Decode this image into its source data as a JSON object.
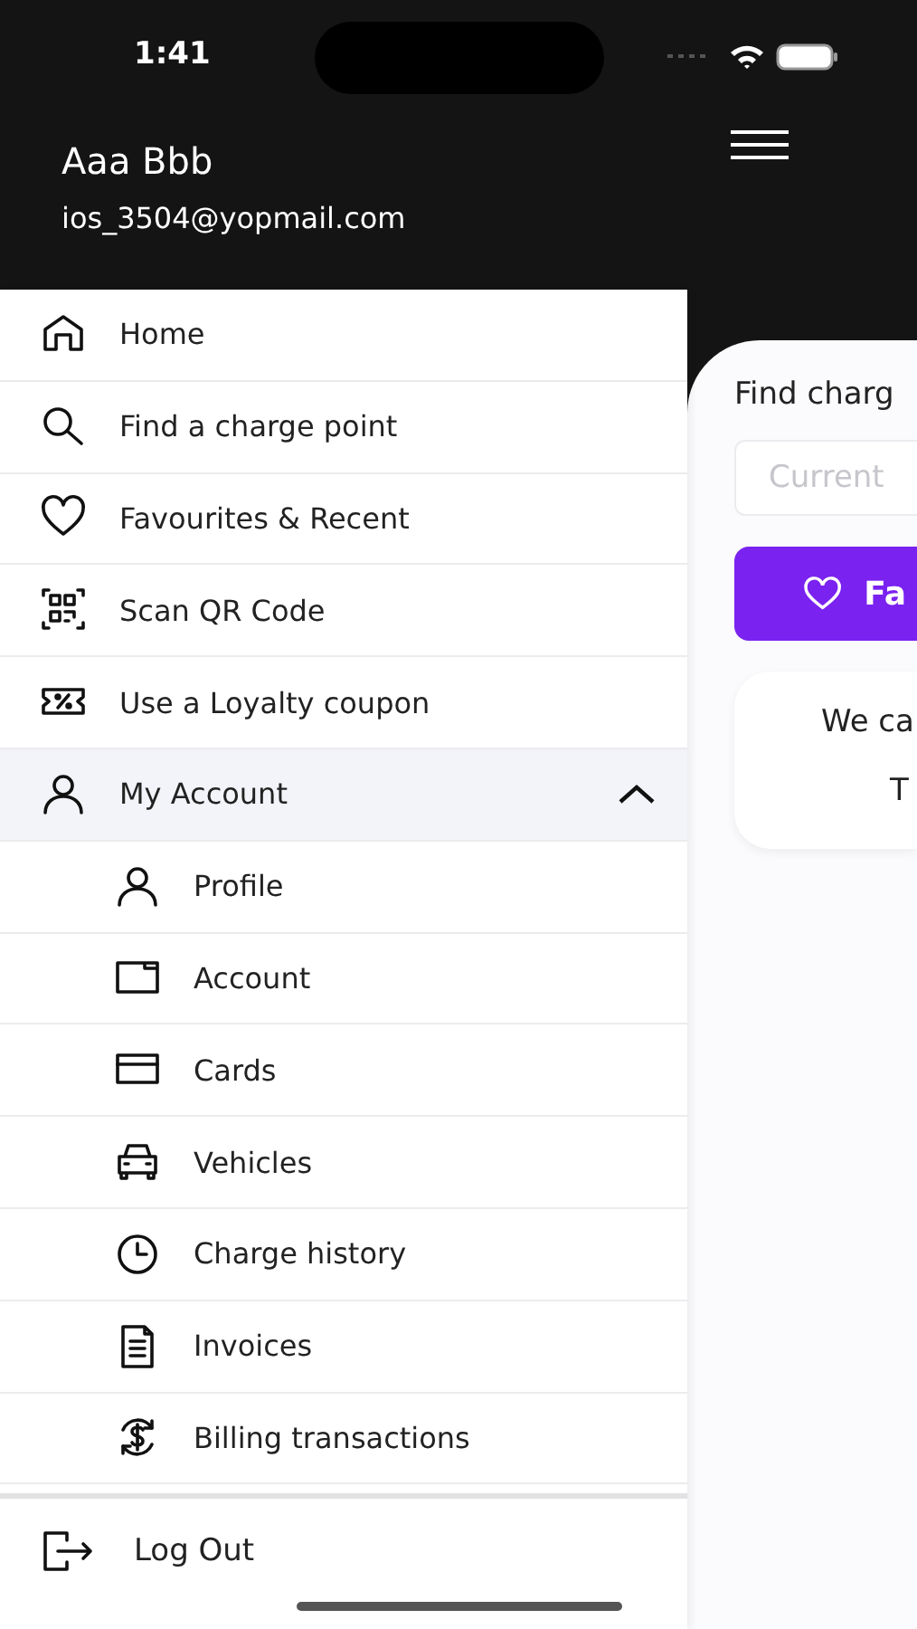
{
  "status_bar": {
    "time": "1:41"
  },
  "drawer": {
    "user_name": "Aaa Bbb",
    "email": "ios_3504@yopmail.com",
    "items": [
      {
        "label": "Home",
        "selected": false
      },
      {
        "label": "Find a charge point",
        "selected": false
      },
      {
        "label": "Favourites & Recent",
        "selected": false
      },
      {
        "label": "Scan QR Code",
        "selected": false
      },
      {
        "label": "Use a Loyalty coupon",
        "selected": false
      },
      {
        "label": "My Account",
        "selected": true,
        "expanded": true,
        "children": [
          {
            "label": "Profile"
          },
          {
            "label": "Account"
          },
          {
            "label": "Cards"
          },
          {
            "label": "Vehicles"
          },
          {
            "label": "Charge history"
          },
          {
            "label": "Invoices"
          },
          {
            "label": "Billing transactions"
          }
        ]
      }
    ],
    "logout": "Log Out"
  },
  "main": {
    "heading": "Find charg",
    "search": {
      "placeholder": "Current"
    },
    "button": "Fa",
    "card_lines": [
      "We ca",
      "T"
    ]
  }
}
